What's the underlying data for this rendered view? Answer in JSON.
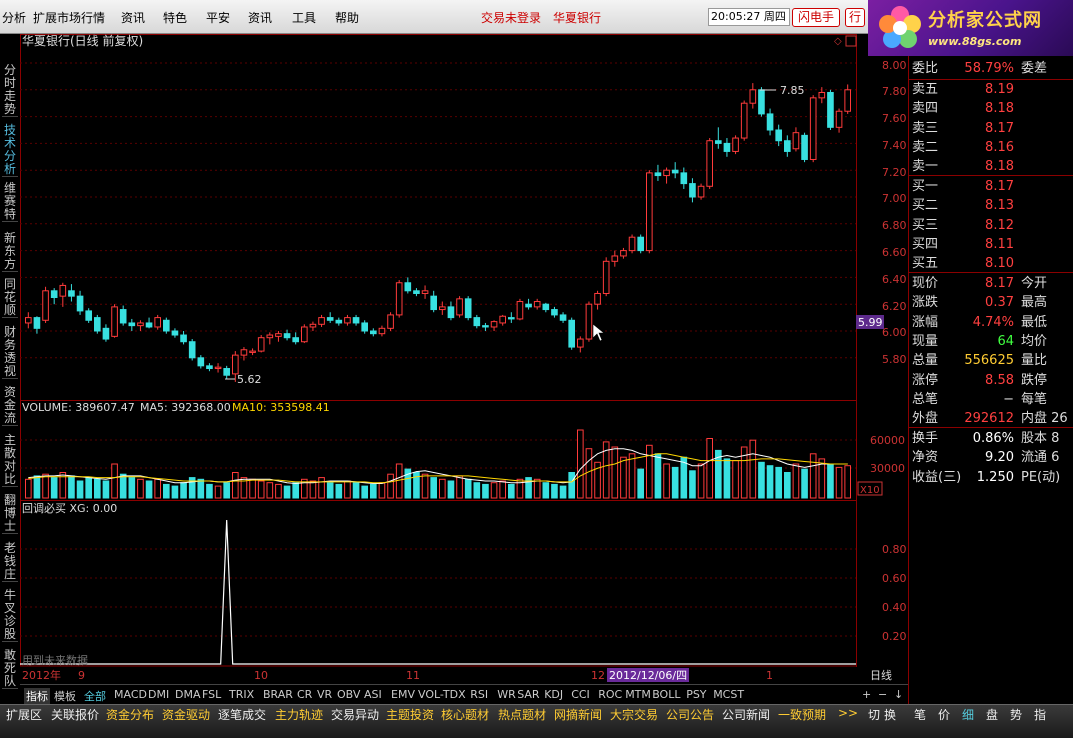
{
  "menu": {
    "items": [
      "分析",
      "扩展市场行情",
      "资讯",
      "特色",
      "平安",
      "资讯",
      "工具",
      "帮助"
    ],
    "login": "交易未登录",
    "stock_link": "华夏银行",
    "clock": "20:05:27 周四",
    "flash_btn": "闪电手",
    "row_btn": "行"
  },
  "logo": {
    "title": "分析家公式网",
    "url": "www.88gs.com"
  },
  "vtabs": [
    "分时走势",
    "技术分析",
    "维赛特",
    "新东方",
    "同花顺",
    "财务透视",
    "资金流",
    "主散对比",
    "翻博士",
    "老钱庄",
    "牛叉诊股",
    "敢死队"
  ],
  "main": {
    "title": "华夏银行(日线 前复权)",
    "price_axis": [
      "8.00",
      "7.80",
      "7.60",
      "7.40",
      "7.20",
      "7.00",
      "6.80",
      "6.60",
      "6.40",
      "6.20",
      "6.00",
      "5.80"
    ],
    "current_tag": "5.99",
    "high_label": "7.85",
    "low_label": "5.62",
    "colors": {
      "up": "#ff3b3b",
      "down": "#38e0e0"
    }
  },
  "volume": {
    "header": "VOLUME: 389607.47",
    "ma5": "MA5: 392368.00",
    "ma10": "MA10: 353598.41",
    "axis": [
      "60000",
      "30000"
    ],
    "unit": "X10"
  },
  "indicator": {
    "header": "回调必买 XG: 0.00",
    "axis": [
      "0.80",
      "0.60",
      "0.40",
      "0.20"
    ],
    "watermark": "用到未来数据"
  },
  "dates": {
    "labels": [
      "2012年",
      "9",
      "10",
      "11",
      "12",
      "1"
    ],
    "cursor": "2012/12/06/四",
    "period": "日线"
  },
  "quote": {
    "ratio": {
      "l": "委比",
      "v": "58.79%",
      "l2": "委差"
    },
    "asks": [
      {
        "l": "卖五",
        "v": "8.19"
      },
      {
        "l": "卖四",
        "v": "8.18"
      },
      {
        "l": "卖三",
        "v": "8.17"
      },
      {
        "l": "卖二",
        "v": "8.16"
      },
      {
        "l": "卖一",
        "v": "8.18"
      }
    ],
    "bids": [
      {
        "l": "买一",
        "v": "8.17"
      },
      {
        "l": "买二",
        "v": "8.13"
      },
      {
        "l": "买三",
        "v": "8.12"
      },
      {
        "l": "买四",
        "v": "8.11"
      },
      {
        "l": "买五",
        "v": "8.10"
      }
    ],
    "stats": [
      {
        "l": "现价",
        "v": "8.17",
        "l2": "今开",
        "c": "#ff4040"
      },
      {
        "l": "涨跌",
        "v": "0.37",
        "l2": "最高",
        "c": "#ff4040"
      },
      {
        "l": "涨幅",
        "v": "4.74%",
        "l2": "最低",
        "c": "#ff4040"
      },
      {
        "l": "现量",
        "v": "64",
        "l2": "均价",
        "c": "#40ff40"
      },
      {
        "l": "总量",
        "v": "556625",
        "l2": "量比",
        "c": "#ffcc33"
      },
      {
        "l": "涨停",
        "v": "8.58",
        "l2": "跌停",
        "c": "#ff4040"
      },
      {
        "l": "总笔",
        "v": "−",
        "l2": "每笔",
        "c": "#ddd"
      },
      {
        "l": "外盘",
        "v": "292612",
        "l2": "内盘 26",
        "c": "#ff4040"
      }
    ],
    "stats2": [
      {
        "l": "换手",
        "v": "0.86%",
        "l2": "股本 8"
      },
      {
        "l": "净资",
        "v": "9.20",
        "l2": "流通 6"
      },
      {
        "l": "收益(三)",
        "v": "1.250",
        "l2": "PE(动)"
      }
    ]
  },
  "indicators": {
    "items": [
      "指标",
      "模板",
      "全部",
      "MACD",
      "DMI",
      "DMA",
      "FSL",
      "TRIX",
      "BRAR",
      "CR",
      "VR",
      "OBV",
      "ASI",
      "EMV",
      "VOL-TDX",
      "RSI",
      "WR",
      "SAR",
      "KDJ",
      "CCI",
      "ROC",
      "MTM",
      "BOLL",
      "PSY",
      "MCST"
    ],
    "controls": [
      "+",
      "−",
      "↓"
    ]
  },
  "bottom": {
    "items": [
      "扩展区",
      "关联报价",
      "资金分布",
      "资金驱动",
      "逐笔成交",
      "主力轨迹",
      "交易异动",
      "主题投资",
      "核心题材",
      "热点题材",
      "网摘新闻",
      "大宗交易",
      "公司公告",
      "公司新闻",
      "一致预期",
      ">>"
    ],
    "extra": [
      "切",
      "换"
    ],
    "right_tabs": [
      "笔",
      "价",
      "细",
      "盘",
      "势",
      "指"
    ]
  },
  "chart_data": {
    "type": "candlestick",
    "series_note": "daily OHLC (yuan)",
    "candles": [
      [
        6.06,
        6.14,
        6.02,
        6.1
      ],
      [
        6.1,
        6.11,
        5.98,
        6.02
      ],
      [
        6.08,
        6.33,
        6.06,
        6.3
      ],
      [
        6.3,
        6.32,
        6.2,
        6.25
      ],
      [
        6.26,
        6.36,
        6.18,
        6.34
      ],
      [
        6.3,
        6.35,
        6.22,
        6.26
      ],
      [
        6.26,
        6.3,
        6.12,
        6.15
      ],
      [
        6.15,
        6.17,
        6.06,
        6.08
      ],
      [
        6.1,
        6.12,
        5.98,
        6.0
      ],
      [
        6.02,
        6.05,
        5.92,
        5.94
      ],
      [
        5.96,
        6.2,
        5.95,
        6.18
      ],
      [
        6.16,
        6.19,
        6.04,
        6.06
      ],
      [
        6.06,
        6.09,
        6.0,
        6.04
      ],
      [
        6.04,
        6.08,
        6.0,
        6.06
      ],
      [
        6.06,
        6.1,
        6.02,
        6.03
      ],
      [
        6.03,
        6.12,
        6.01,
        6.1
      ],
      [
        6.08,
        6.1,
        5.98,
        6.0
      ],
      [
        6.0,
        6.02,
        5.95,
        5.97
      ],
      [
        5.97,
        6.0,
        5.9,
        5.92
      ],
      [
        5.92,
        5.94,
        5.78,
        5.8
      ],
      [
        5.8,
        5.82,
        5.72,
        5.74
      ],
      [
        5.74,
        5.76,
        5.7,
        5.72
      ],
      [
        5.72,
        5.76,
        5.69,
        5.73
      ],
      [
        5.72,
        5.74,
        5.64,
        5.67
      ],
      [
        5.68,
        5.85,
        5.62,
        5.82
      ],
      [
        5.82,
        5.88,
        5.78,
        5.86
      ],
      [
        5.84,
        5.87,
        5.82,
        5.85
      ],
      [
        5.85,
        5.97,
        5.84,
        5.95
      ],
      [
        5.95,
        5.99,
        5.9,
        5.97
      ],
      [
        5.96,
        6.0,
        5.92,
        5.98
      ],
      [
        5.98,
        6.01,
        5.93,
        5.95
      ],
      [
        5.95,
        5.99,
        5.9,
        5.92
      ],
      [
        5.92,
        6.05,
        5.91,
        6.03
      ],
      [
        6.03,
        6.07,
        6.0,
        6.05
      ],
      [
        6.05,
        6.12,
        6.03,
        6.1
      ],
      [
        6.1,
        6.14,
        6.06,
        6.08
      ],
      [
        6.08,
        6.1,
        6.04,
        6.06
      ],
      [
        6.06,
        6.12,
        6.04,
        6.1
      ],
      [
        6.1,
        6.12,
        6.04,
        6.06
      ],
      [
        6.06,
        6.08,
        5.98,
        6.0
      ],
      [
        6.0,
        6.02,
        5.96,
        5.98
      ],
      [
        5.98,
        6.04,
        5.96,
        6.02
      ],
      [
        6.02,
        6.14,
        6.0,
        6.12
      ],
      [
        6.12,
        6.38,
        6.1,
        6.36
      ],
      [
        6.36,
        6.4,
        6.28,
        6.3
      ],
      [
        6.3,
        6.32,
        6.26,
        6.28
      ],
      [
        6.28,
        6.34,
        6.24,
        6.3
      ],
      [
        6.26,
        6.3,
        6.14,
        6.16
      ],
      [
        6.16,
        6.22,
        6.12,
        6.18
      ],
      [
        6.18,
        6.22,
        6.08,
        6.1
      ],
      [
        6.12,
        6.26,
        6.1,
        6.24
      ],
      [
        6.24,
        6.26,
        6.08,
        6.1
      ],
      [
        6.1,
        6.12,
        6.02,
        6.04
      ],
      [
        6.04,
        6.06,
        6.0,
        6.03
      ],
      [
        6.03,
        6.08,
        6.0,
        6.07
      ],
      [
        6.06,
        6.12,
        6.04,
        6.11
      ],
      [
        6.1,
        6.14,
        6.06,
        6.09
      ],
      [
        6.09,
        6.24,
        6.08,
        6.22
      ],
      [
        6.2,
        6.24,
        6.16,
        6.18
      ],
      [
        6.18,
        6.24,
        6.16,
        6.22
      ],
      [
        6.2,
        6.21,
        6.14,
        6.16
      ],
      [
        6.16,
        6.18,
        6.1,
        6.12
      ],
      [
        6.12,
        6.14,
        6.06,
        6.08
      ],
      [
        6.08,
        6.1,
        5.86,
        5.88
      ],
      [
        5.88,
        5.96,
        5.84,
        5.94
      ],
      [
        5.94,
        6.22,
        5.92,
        6.2
      ],
      [
        6.2,
        6.3,
        6.16,
        6.28
      ],
      [
        6.28,
        6.55,
        6.26,
        6.52
      ],
      [
        6.52,
        6.6,
        6.48,
        6.56
      ],
      [
        6.56,
        6.62,
        6.54,
        6.6
      ],
      [
        6.6,
        6.72,
        6.58,
        6.7
      ],
      [
        6.7,
        6.72,
        6.58,
        6.6
      ],
      [
        6.6,
        7.2,
        6.58,
        7.18
      ],
      [
        7.18,
        7.24,
        7.12,
        7.16
      ],
      [
        7.16,
        7.22,
        7.1,
        7.2
      ],
      [
        7.2,
        7.26,
        7.14,
        7.18
      ],
      [
        7.18,
        7.22,
        7.06,
        7.1
      ],
      [
        7.1,
        7.14,
        6.96,
        7.0
      ],
      [
        7.0,
        7.1,
        6.98,
        7.08
      ],
      [
        7.08,
        7.44,
        7.06,
        7.42
      ],
      [
        7.42,
        7.52,
        7.36,
        7.4
      ],
      [
        7.4,
        7.44,
        7.3,
        7.34
      ],
      [
        7.34,
        7.46,
        7.32,
        7.44
      ],
      [
        7.44,
        7.72,
        7.42,
        7.7
      ],
      [
        7.7,
        7.85,
        7.66,
        7.8
      ],
      [
        7.8,
        7.82,
        7.6,
        7.62
      ],
      [
        7.62,
        7.66,
        7.46,
        7.5
      ],
      [
        7.5,
        7.54,
        7.38,
        7.42
      ],
      [
        7.42,
        7.46,
        7.3,
        7.34
      ],
      [
        7.36,
        7.52,
        7.34,
        7.48
      ],
      [
        7.46,
        7.48,
        7.26,
        7.28
      ],
      [
        7.28,
        7.76,
        7.26,
        7.74
      ],
      [
        7.74,
        7.82,
        7.7,
        7.78
      ],
      [
        7.78,
        7.8,
        7.5,
        7.52
      ],
      [
        7.52,
        7.66,
        7.48,
        7.64
      ],
      [
        7.64,
        7.84,
        7.62,
        7.8
      ]
    ],
    "volume": [
      22,
      26,
      28,
      24,
      30,
      26,
      20,
      24,
      22,
      20,
      40,
      28,
      24,
      22,
      20,
      22,
      16,
      14,
      18,
      24,
      22,
      16,
      14,
      18,
      30,
      24,
      22,
      20,
      18,
      16,
      14,
      18,
      22,
      20,
      24,
      18,
      16,
      20,
      18,
      14,
      16,
      18,
      28,
      40,
      34,
      30,
      28,
      24,
      22,
      20,
      26,
      22,
      18,
      16,
      18,
      20,
      16,
      22,
      24,
      22,
      18,
      16,
      14,
      30,
      80,
      58,
      42,
      66,
      60,
      48,
      52,
      34,
      62,
      52,
      40,
      36,
      48,
      32,
      40,
      70,
      56,
      46,
      44,
      60,
      68,
      42,
      38,
      36,
      30,
      40,
      34,
      52,
      46,
      40,
      36,
      38
    ],
    "ma5": [
      24,
      25,
      26,
      26,
      27,
      26,
      25,
      24,
      23,
      22,
      24,
      26,
      26,
      26,
      24,
      22,
      20,
      18,
      18,
      19,
      20,
      20,
      19,
      19,
      21,
      22,
      22,
      22,
      22,
      20,
      18,
      17,
      18,
      18,
      19,
      20,
      20,
      20,
      19,
      18,
      17,
      17,
      20,
      24,
      28,
      31,
      32,
      30,
      28,
      26,
      24,
      22,
      21,
      20,
      20,
      19,
      18,
      18,
      19,
      20,
      20,
      19,
      18,
      19,
      34,
      44,
      52,
      56,
      58,
      58,
      56,
      52,
      50,
      48,
      46,
      44,
      42,
      38,
      38,
      44,
      48,
      50,
      48,
      50,
      52,
      50,
      48,
      44,
      40,
      38,
      36,
      38,
      40,
      40,
      40,
      40
    ],
    "ma10": [
      23,
      24,
      25,
      25,
      25,
      25,
      25,
      25,
      24,
      24,
      24,
      25,
      25,
      25,
      24,
      23,
      22,
      21,
      20,
      20,
      20,
      20,
      19,
      19,
      20,
      20,
      21,
      21,
      21,
      21,
      20,
      19,
      19,
      19,
      19,
      19,
      19,
      19,
      19,
      19,
      18,
      18,
      19,
      21,
      23,
      25,
      26,
      26,
      26,
      26,
      26,
      26,
      25,
      24,
      23,
      22,
      21,
      20,
      20,
      20,
      20,
      19,
      19,
      19,
      26,
      31,
      35,
      38,
      40,
      44,
      46,
      48,
      50,
      52,
      52,
      50,
      48,
      46,
      44,
      44,
      44,
      44,
      44,
      44,
      45,
      46,
      46,
      46,
      45,
      44,
      43,
      42,
      41,
      40,
      40,
      40
    ],
    "xg_peak_index": 23,
    "price_range": [
      5.52,
      8.07
    ],
    "volume_range": [
      0,
      80000
    ]
  }
}
